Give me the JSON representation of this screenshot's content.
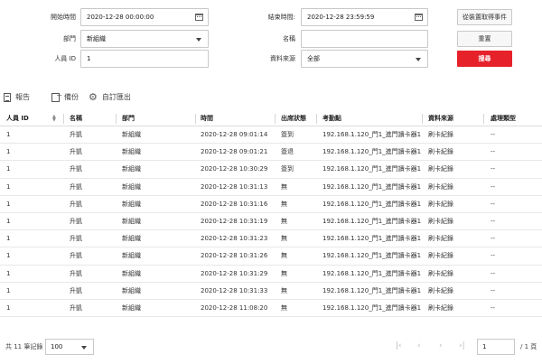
{
  "filters": {
    "start_time_label": "開始時間",
    "start_time_value": "2020-12-28 00:00:00",
    "end_time_label": "結束時間:",
    "end_time_value": "2020-12-28 23:59:59",
    "department_label": "部門",
    "department_value": "新組織",
    "name_label": "名稱",
    "name_value": "",
    "person_id_label": "人員 ID",
    "person_id_value": "1",
    "data_source_label": "資料來源",
    "data_source_value": "全部"
  },
  "buttons": {
    "get_events": "從裝置取得事件",
    "reset": "重置",
    "search": "搜尋"
  },
  "toolbar": {
    "report": "報告",
    "backup": "備份",
    "custom_export": "自訂匯出"
  },
  "table": {
    "headers": [
      "人員 ID",
      "名稱",
      "部門",
      "時間",
      "出席狀態",
      "考勤點",
      "資料來源",
      "處理類型"
    ],
    "rows": [
      [
        "1",
        "升凱",
        "新組織",
        "2020-12-28 09:01:14",
        "簽到",
        "192.168.1.120_門1_進門讀卡器1",
        "刷卡紀錄",
        "--"
      ],
      [
        "1",
        "升凱",
        "新組織",
        "2020-12-28 09:01:21",
        "簽退",
        "192.168.1.120_門1_進門讀卡器1",
        "刷卡紀錄",
        "--"
      ],
      [
        "1",
        "升凱",
        "新組織",
        "2020-12-28 10:30:29",
        "簽到",
        "192.168.1.120_門1_進門讀卡器1",
        "刷卡紀錄",
        "--"
      ],
      [
        "1",
        "升凱",
        "新組織",
        "2020-12-28 10:31:13",
        "無",
        "192.168.1.120_門1_進門讀卡器1",
        "刷卡紀錄",
        "--"
      ],
      [
        "1",
        "升凱",
        "新組織",
        "2020-12-28 10:31:16",
        "無",
        "192.168.1.120_門1_進門讀卡器1",
        "刷卡紀錄",
        "--"
      ],
      [
        "1",
        "升凱",
        "新組織",
        "2020-12-28 10:31:19",
        "無",
        "192.168.1.120_門1_進門讀卡器1",
        "刷卡紀錄",
        "--"
      ],
      [
        "1",
        "升凱",
        "新組織",
        "2020-12-28 10:31:23",
        "無",
        "192.168.1.120_門1_進門讀卡器1",
        "刷卡紀錄",
        "--"
      ],
      [
        "1",
        "升凱",
        "新組織",
        "2020-12-28 10:31:26",
        "無",
        "192.168.1.120_門1_進門讀卡器1",
        "刷卡紀錄",
        "--"
      ],
      [
        "1",
        "升凱",
        "新組織",
        "2020-12-28 10:31:29",
        "無",
        "192.168.1.120_門1_進門讀卡器1",
        "刷卡紀錄",
        "--"
      ],
      [
        "1",
        "升凱",
        "新組織",
        "2020-12-28 10:31:33",
        "無",
        "192.168.1.120_門1_進門讀卡器1",
        "刷卡紀錄",
        "--"
      ],
      [
        "1",
        "升凱",
        "新組織",
        "2020-12-28 11:08:20",
        "無",
        "192.168.1.120_門1_進門讀卡器1",
        "刷卡紀錄",
        "--"
      ]
    ]
  },
  "footer": {
    "total_records": "共 11 筆記錄",
    "page_size": "100",
    "current_page": "1",
    "total_pages": "/ 1 頁"
  },
  "colors": {
    "primary_button": "#e6212a"
  }
}
